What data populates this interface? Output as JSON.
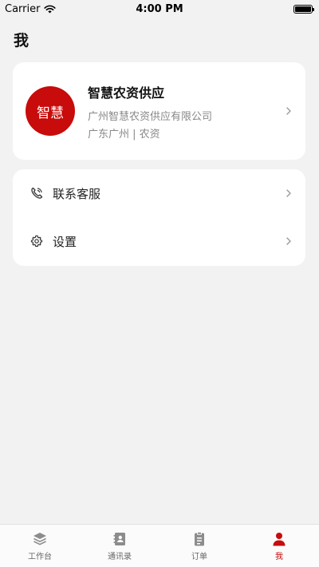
{
  "status_bar": {
    "carrier": "Carrier",
    "time": "4:00 PM"
  },
  "page": {
    "title": "我"
  },
  "profile": {
    "avatar_text": "智慧",
    "name": "智慧农资供应",
    "company": "广州智慧农资供应有限公司",
    "region": "广东广州 | 农资"
  },
  "menu": {
    "items": [
      {
        "label": "联系客服",
        "icon": "phone-icon"
      },
      {
        "label": "设置",
        "icon": "gear-icon"
      }
    ]
  },
  "tabbar": {
    "items": [
      {
        "label": "工作台",
        "icon": "layers-icon"
      },
      {
        "label": "通讯录",
        "icon": "contacts-icon"
      },
      {
        "label": "订单",
        "icon": "clipboard-icon"
      },
      {
        "label": "我",
        "icon": "user-icon"
      }
    ]
  },
  "colors": {
    "accent": "#c80b0b",
    "background": "#f2f2f2",
    "card": "#ffffff"
  }
}
